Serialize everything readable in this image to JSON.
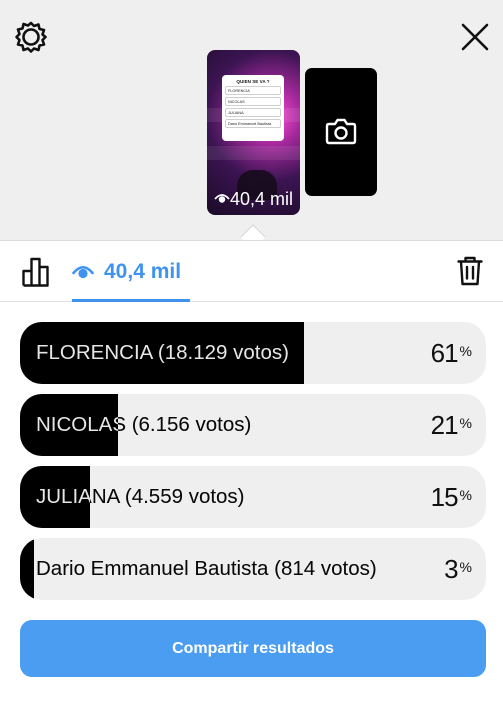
{
  "header": {
    "settings_icon": "gear-icon",
    "close_icon": "close-icon"
  },
  "story": {
    "poll_question": "QUIEN SE VA ?",
    "poll_options": [
      "FLORENCIA",
      "NICOLAS",
      "JULIANA",
      "Dario Emmanuel Bautista"
    ],
    "views": "40,4 mil"
  },
  "toolbar": {
    "views_label": "40,4 mil",
    "accent": "#3f93f0"
  },
  "results": [
    {
      "label": "FLORENCIA (18.129 votos)",
      "percent": 61
    },
    {
      "label": "NICOLAS (6.156 votos)",
      "percent": 21
    },
    {
      "label": "JULIANA (4.559 votos)",
      "percent": 15
    },
    {
      "label": "Dario Emmanuel Bautista (814 votos)",
      "percent": 3
    }
  ],
  "percent_symbol": "%",
  "share_button": {
    "label": "Compartir resultados",
    "color": "#4a9df1"
  }
}
